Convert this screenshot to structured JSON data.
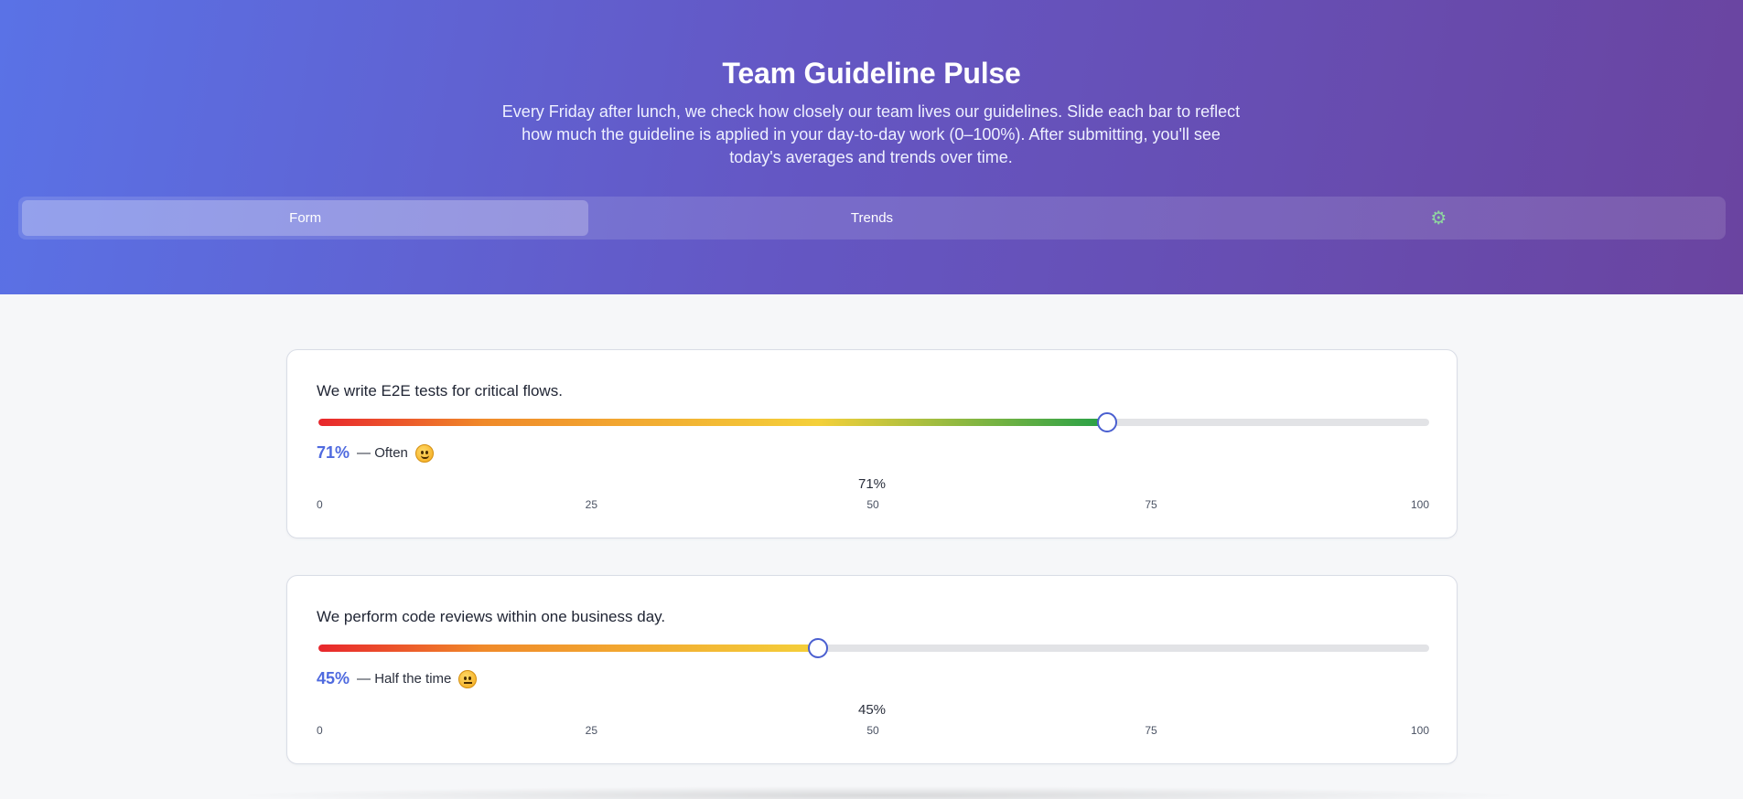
{
  "header": {
    "title": "Team Guideline Pulse",
    "subtitle": "Every Friday after lunch, we check how closely our team lives our guidelines. Slide each bar to reflect how much the guideline is applied in your day-to-day work (0–100%). After submitting, you'll see today's averages and trends over time."
  },
  "tabs": [
    {
      "label": "Form",
      "active": true
    },
    {
      "label": "Trends",
      "active": false
    },
    {
      "label": "⚙",
      "icon": "gear-icon",
      "active": false
    }
  ],
  "colors": {
    "accent": "#4f6adf",
    "gradient_start": "#e8262c",
    "gradient_mid": "#f4d03a",
    "gradient_end": "#26a047"
  },
  "questions": [
    {
      "text": "We write E2E tests for critical flows.",
      "value": 71,
      "value_text": "71%",
      "label": "— Often",
      "emoji": "smile-emoji",
      "center_text": "71%"
    },
    {
      "text": "We perform code reviews within one business day.",
      "value": 45,
      "value_text": "45%",
      "label": "— Half the time",
      "emoji": "neutral-emoji",
      "center_text": "45%"
    }
  ],
  "scale": [
    "0",
    "25",
    "50",
    "75",
    "100"
  ]
}
